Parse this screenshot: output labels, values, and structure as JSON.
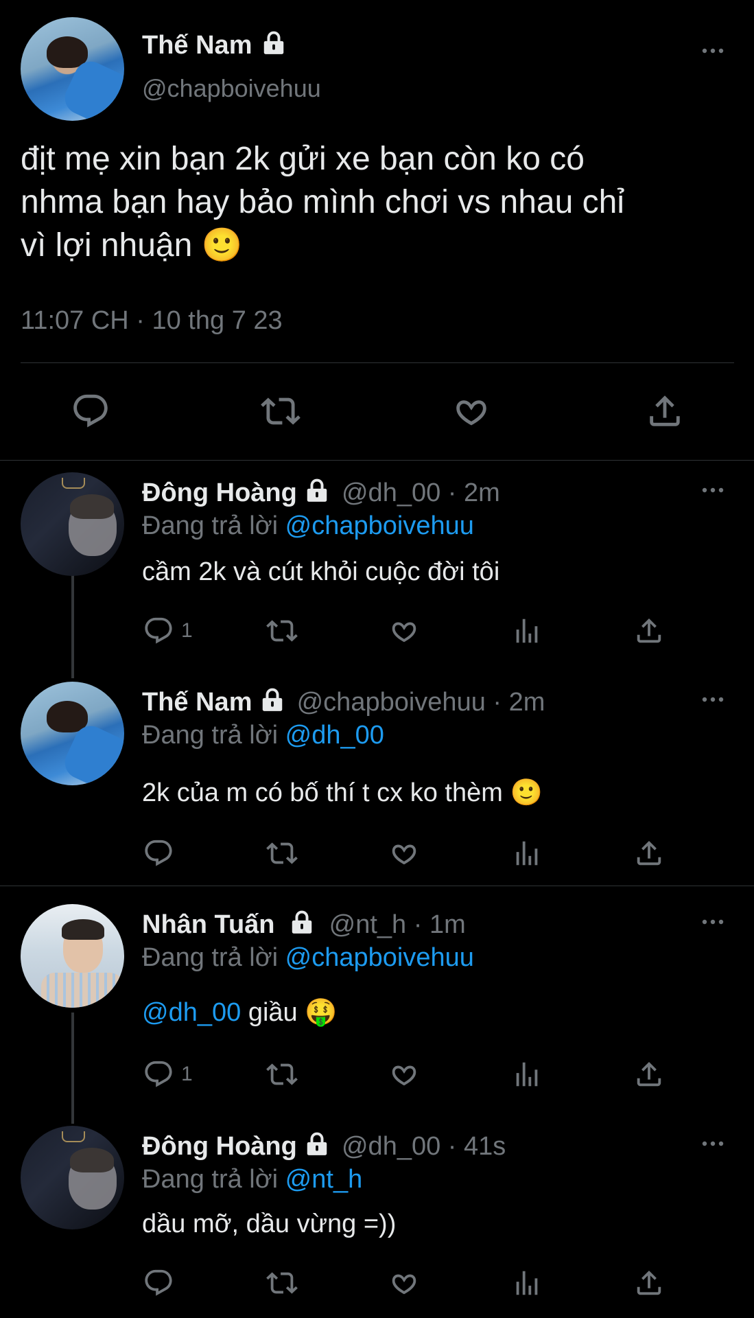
{
  "main_tweet": {
    "name": "Thế Nam",
    "handle": "@chapboivehuu",
    "text_lines": [
      "địt mẹ xin bạn 2k gửi xe bạn còn ko có",
      "nhma bạn hay bảo mình chơi vs nhau chỉ",
      "vì lợi nhuận 🙂"
    ],
    "timestamp": "11:07 CH · 10 thg 7 23"
  },
  "replies": [
    {
      "name": "Đông Hoàng",
      "handle_time": "@dh_00 · 2m",
      "replying_prefix": "Đang trả lời",
      "replying_to": "@chapboivehuu",
      "text": "cầm 2k và cút khỏi cuộc đời tôi",
      "reply_count": "1"
    },
    {
      "name": "Thế Nam",
      "handle_time": "@chapboivehuu · 2m",
      "replying_prefix": "Đang trả lời",
      "replying_to": "@dh_00",
      "text": "2k của m có bố thí t cx ko thèm 🙂",
      "reply_count": ""
    },
    {
      "name": "Nhân Tuấn",
      "handle_time": "@nt_h · 1m",
      "replying_prefix": "Đang trả lời",
      "replying_to": "@chapboivehuu",
      "mention": "@dh_00",
      "text": "giầu 🤑",
      "reply_count": "1"
    },
    {
      "name": "Đông Hoàng",
      "handle_time": "@dh_00 · 41s",
      "replying_prefix": "Đang trả lời",
      "replying_to": "@nt_h",
      "text": "dầu mỡ, dầu vừng =))",
      "reply_count": ""
    }
  ],
  "colors": {
    "background": "#000000",
    "text": "#e7e9ea",
    "secondary": "#71767b",
    "accent": "#1d9bf0",
    "divider": "#2f3336"
  },
  "icons": [
    "lock-icon",
    "more-icon",
    "reply-icon",
    "retweet-icon",
    "like-icon",
    "share-icon",
    "analytics-icon"
  ]
}
